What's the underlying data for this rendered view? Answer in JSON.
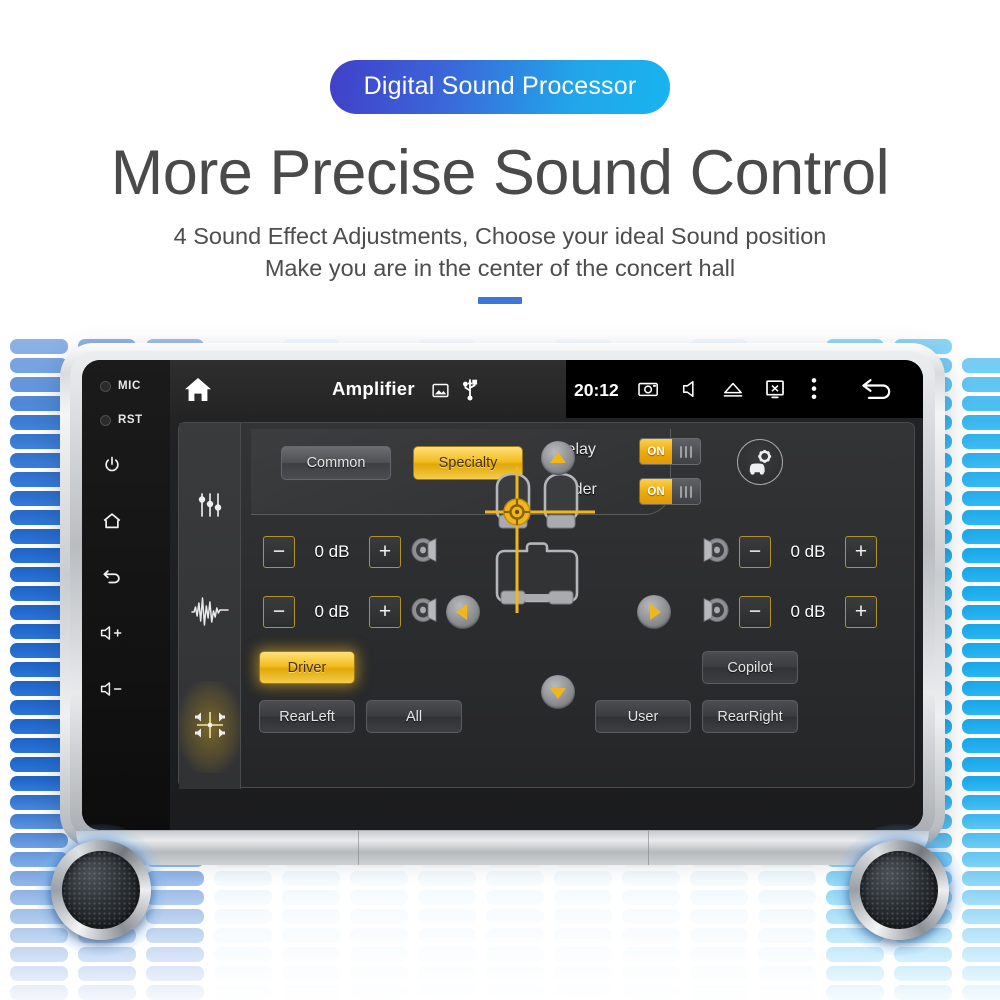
{
  "header": {
    "badge": "Digital Sound Processor",
    "title": "More Precise Sound Control",
    "subtitle_line1": "4 Sound Effect Adjustments, Choose your ideal Sound position",
    "subtitle_line2": "Make you are in the center of the concert hall",
    "accent_blue": "#3f75d6",
    "badge_gradient_from": "#4040c8",
    "badge_gradient_to": "#17b4f0"
  },
  "device": {
    "side_keys": {
      "mic_label": "MIC",
      "rst_label": "RST",
      "icons": [
        "power-icon",
        "home-icon",
        "back-icon",
        "volume-up-icon",
        "volume-down-icon"
      ]
    },
    "statusbar": {
      "home_icon": "home-icon",
      "title": "Amplifier",
      "sd_icon": "sd-card-icon",
      "usb_icon": "usb-icon",
      "clock": "20:12",
      "camera_icon": "camera-icon",
      "mute_icon": "mute-icon",
      "eject_icon": "eject-icon",
      "screen_off_icon": "screen-off-icon",
      "overflow_icon": "more-vertical-icon",
      "back_icon": "back-arrow-icon"
    }
  },
  "app": {
    "tabs": [
      {
        "name": "equalizer-tab",
        "icon": "sliders-icon",
        "active": false
      },
      {
        "name": "waveform-tab",
        "icon": "waveform-icon",
        "active": false
      },
      {
        "name": "surround-tab",
        "icon": "surround-speakers-icon",
        "active": true
      }
    ],
    "modes": [
      {
        "label": "Common",
        "active": false
      },
      {
        "label": "Specialty",
        "active": true
      }
    ],
    "switches": [
      {
        "label": "Delay",
        "state": "ON"
      },
      {
        "label": "Fader",
        "state": "ON"
      }
    ],
    "car_settings_icon": "car-gear-icon",
    "gain_controls": [
      {
        "position": "front-left",
        "minus": "−",
        "value": "0 dB",
        "plus": "+",
        "speaker_icon": "speaker-icon"
      },
      {
        "position": "rear-left",
        "minus": "−",
        "value": "0 dB",
        "plus": "+",
        "speaker_icon": "speaker-icon"
      },
      {
        "position": "front-right",
        "minus": "−",
        "value": "0 dB",
        "plus": "+",
        "speaker_icon": "speaker-icon"
      },
      {
        "position": "rear-right",
        "minus": "−",
        "value": "0 dB",
        "plus": "+",
        "speaker_icon": "speaker-icon"
      }
    ],
    "dpad": {
      "up_icon": "triangle-up-icon",
      "down_icon": "triangle-down-icon",
      "left_icon": "triangle-left-icon",
      "right_icon": "triangle-right-icon"
    },
    "seat_presets": [
      {
        "label": "Driver",
        "active": true
      },
      {
        "label": "Copilot",
        "active": false
      },
      {
        "label": "RearLeft",
        "active": false
      },
      {
        "label": "All",
        "active": false
      },
      {
        "label": "User",
        "active": false
      },
      {
        "label": "RearRight",
        "active": false
      }
    ],
    "accent_gold": "#f2bc20"
  }
}
